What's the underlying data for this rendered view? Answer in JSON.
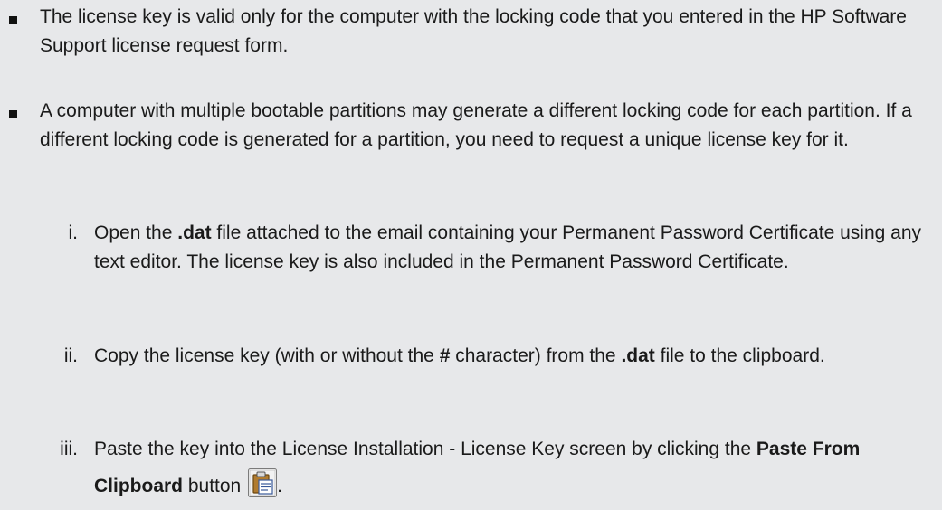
{
  "bullets": [
    {
      "text": "The license key is valid only for the computer with the locking code that you entered in the HP Software Support license request form."
    },
    {
      "text": "A computer with multiple bootable partitions may generate a different locking code for each partition. If a different locking code is generated for a partition, you need to request a unique license key for it."
    }
  ],
  "steps": [
    {
      "marker": "i.",
      "pre": "Open the ",
      "bold1": ".dat",
      "post": " file attached to the email containing your Permanent Password Certificate using any text editor. The license key is also included in the Permanent Password Certificate."
    },
    {
      "marker": "ii.",
      "pre": "Copy the license key (with or without the ",
      "bold1": "#",
      "mid": " character) from the ",
      "bold2": ".dat",
      "post": " file to the clipboard."
    },
    {
      "marker": "iii.",
      "pre": "Paste the key into the License Installation - License Key screen by clicking the ",
      "bold1": "Paste From Clipboard",
      "post": " button ",
      "end": ".",
      "icon": "paste-from-clipboard-icon"
    }
  ]
}
